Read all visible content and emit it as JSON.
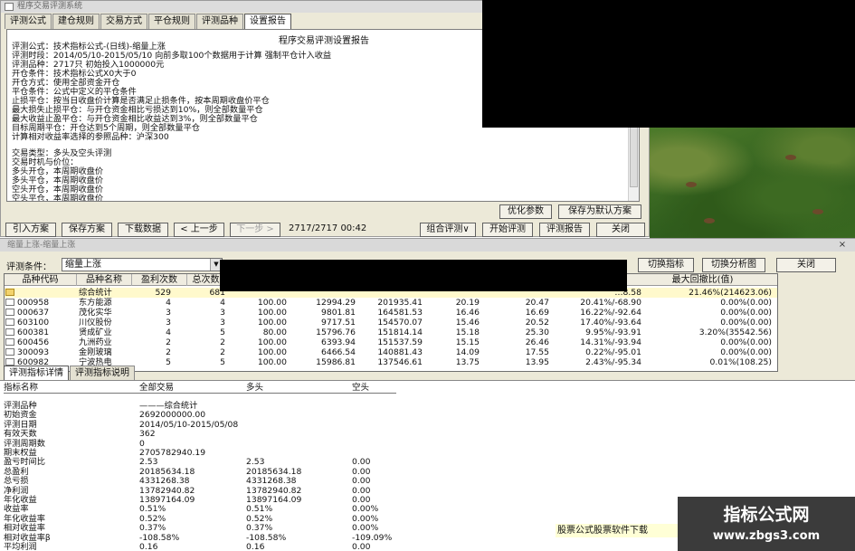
{
  "top_window": {
    "title": "程序交易评测系统",
    "tabs": [
      "评测公式",
      "建仓规则",
      "交易方式",
      "平仓规则",
      "评测品种",
      "设置报告"
    ],
    "active_tab_index": 5,
    "report_title": "程序交易评测设置报告",
    "report_lines": [
      "评测公式：技术指标公式-(日线)-缩量上涨",
      "评测时段：2014/05/10-2015/05/10  向前多取100个数据用于计算  强制平仓计入收益",
      "评测品种：2717只  初始投入1000000元",
      "开仓条件：技术指标公式X0大于0",
      "开仓方式：使用全部资金开仓",
      "平仓条件：公式中定义的平仓条件",
      "止损平仓：按当日收盘价计算是否满足止损条件，按本周期收盘价平仓",
      "        最大损失止损平仓：与开仓资金相比亏损达到10%，则全部数量平仓",
      "        最大收益止盈平仓：与开仓资金相比收益达到3%，则全部数量平仓",
      "        目标周期平仓：开仓达到5个周期，则全部数量平仓",
      "        计算相对收益率选择的参照品种：沪深300",
      "",
      "交易类型：多头及空头评测",
      "交易时机与价位：",
      "        多头开仓，本周期收盘价",
      "        多头平仓，本周期收盘价",
      "        空头开仓，本周期收盘价",
      "        空头平仓，本周期收盘价"
    ],
    "buttons": {
      "optimize": "优化参数",
      "save_default": "保存为默认方案",
      "import": "引入方案",
      "save": "保存方案",
      "download": "下载数据",
      "prev": "< 上一步",
      "next": "下一步 >",
      "combo": "组合评测∨",
      "start": "开始评测",
      "report": "评测报告",
      "close": "关闭"
    },
    "progress_text": "2717/2717  00:42"
  },
  "bottom_window": {
    "title": "缩量上涨-缩量上涨",
    "close_icon": "×",
    "condition_label": "评测条件：",
    "condition_value": "缩量上涨",
    "buttons": {
      "switch_indicator": "切换指标",
      "switch_chart": "切换分析图",
      "close": "关闭"
    },
    "grid_columns": [
      "品种代码",
      "品种名称",
      "盈利次数",
      "总次数",
      "",
      "",
      "",
      "",
      "",
      "",
      "最大回撤比(值)"
    ],
    "grid_rows": [
      {
        "icon": "folder-icon",
        "code": "",
        "name": "综合统计",
        "win": "529",
        "total": "681",
        "c4": "",
        "c5": "",
        "c6": "",
        "c7": "",
        "c8": "",
        "c9": "",
        "c10": "…8.58",
        "dd": "21.46%(214623.06)"
      },
      {
        "icon": "file-icon",
        "code": "000958",
        "name": "东方能源",
        "win": "4",
        "total": "4",
        "c4": "100.00",
        "c5": "12994.29",
        "c6": "201935.41",
        "c7": "20.19",
        "c8": "20.47",
        "c9": "",
        "c10": "20.41%/-68.90",
        "dd": "0.00%(0.00)"
      },
      {
        "icon": "file-icon",
        "code": "000637",
        "name": "茂化实华",
        "win": "3",
        "total": "3",
        "c4": "100.00",
        "c5": "9801.81",
        "c6": "164581.53",
        "c7": "16.46",
        "c8": "16.69",
        "c9": "",
        "c10": "16.22%/-92.64",
        "dd": "0.00%(0.00)"
      },
      {
        "icon": "file-icon",
        "code": "603100",
        "name": "川仪股份",
        "win": "3",
        "total": "3",
        "c4": "100.00",
        "c5": "9717.51",
        "c6": "154570.07",
        "c7": "15.46",
        "c8": "20.52",
        "c9": "",
        "c10": "17.40%/-93.64",
        "dd": "0.00%(0.00)"
      },
      {
        "icon": "file-icon",
        "code": "600381",
        "name": "贤成矿业",
        "win": "4",
        "total": "5",
        "c4": "80.00",
        "c5": "15796.76",
        "c6": "151814.14",
        "c7": "15.18",
        "c8": "25.30",
        "c9": "",
        "c10": "9.95%/-93.91",
        "dd": "3.20%(35542.56)"
      },
      {
        "icon": "file-icon",
        "code": "600456",
        "name": "九洲药业",
        "win": "2",
        "total": "2",
        "c4": "100.00",
        "c5": "6393.94",
        "c6": "151537.59",
        "c7": "15.15",
        "c8": "26.46",
        "c9": "",
        "c10": "14.31%/-93.94",
        "dd": "0.00%(0.00)"
      },
      {
        "icon": "file-icon",
        "code": "300093",
        "name": "金刚玻璃",
        "win": "2",
        "total": "2",
        "c4": "100.00",
        "c5": "6466.54",
        "c6": "140881.43",
        "c7": "14.09",
        "c8": "17.55",
        "c9": "",
        "c10": "0.22%/-95.01",
        "dd": "0.00%(0.00)"
      },
      {
        "icon": "file-icon",
        "code": "600982",
        "name": "宁波热电",
        "win": "5",
        "total": "5",
        "c4": "100.00",
        "c5": "15986.81",
        "c6": "137546.61",
        "c7": "13.75",
        "c8": "13.95",
        "c9": "",
        "c10": "2.43%/-95.34",
        "dd": "0.01%(108.25)"
      }
    ],
    "detail_tabs": [
      "评测指标详情",
      "评测指标说明"
    ],
    "detail_header": [
      "指标名称",
      "全部交易",
      "多头",
      "空头"
    ],
    "detail_rows": [
      [
        "评测品种",
        "———综合统计",
        "",
        ""
      ],
      [
        "初始资金",
        "2692000000.00",
        "",
        ""
      ],
      [
        "评测日期",
        "2014/05/10-2015/05/08",
        "",
        ""
      ],
      [
        "有效天数",
        "362",
        "",
        ""
      ],
      [
        "评测周期数",
        "0",
        "",
        ""
      ],
      [
        "期末权益",
        "2705782940.19",
        "",
        ""
      ],
      [
        "盈亏时间比",
        "2.53",
        "2.53",
        "0.00"
      ],
      [
        "总盈利",
        "20185634.18",
        "20185634.18",
        "0.00"
      ],
      [
        "总亏损",
        "4331268.38",
        "4331268.38",
        "0.00"
      ],
      [
        "净利润",
        "13782940.82",
        "13782940.82",
        "0.00"
      ],
      [
        "年化收益",
        "13897164.09",
        "13897164.09",
        "0.00"
      ],
      [
        "收益率",
        "0.51%",
        "0.51%",
        "0.00%"
      ],
      [
        "年化收益率",
        "0.52%",
        "0.52%",
        "0.00%"
      ],
      [
        "相对收益率",
        "0.37%",
        "0.37%",
        "0.00%"
      ],
      [
        "相对收益率β",
        "-108.58%",
        "-108.58%",
        "-109.09%"
      ],
      [
        "平均利润",
        "0.16",
        "0.16",
        "0.00"
      ]
    ],
    "watermark_strip": "股票公式股票软件下载",
    "watermark_title": "指标公式网",
    "watermark_url": "www.zbgs3.com"
  }
}
